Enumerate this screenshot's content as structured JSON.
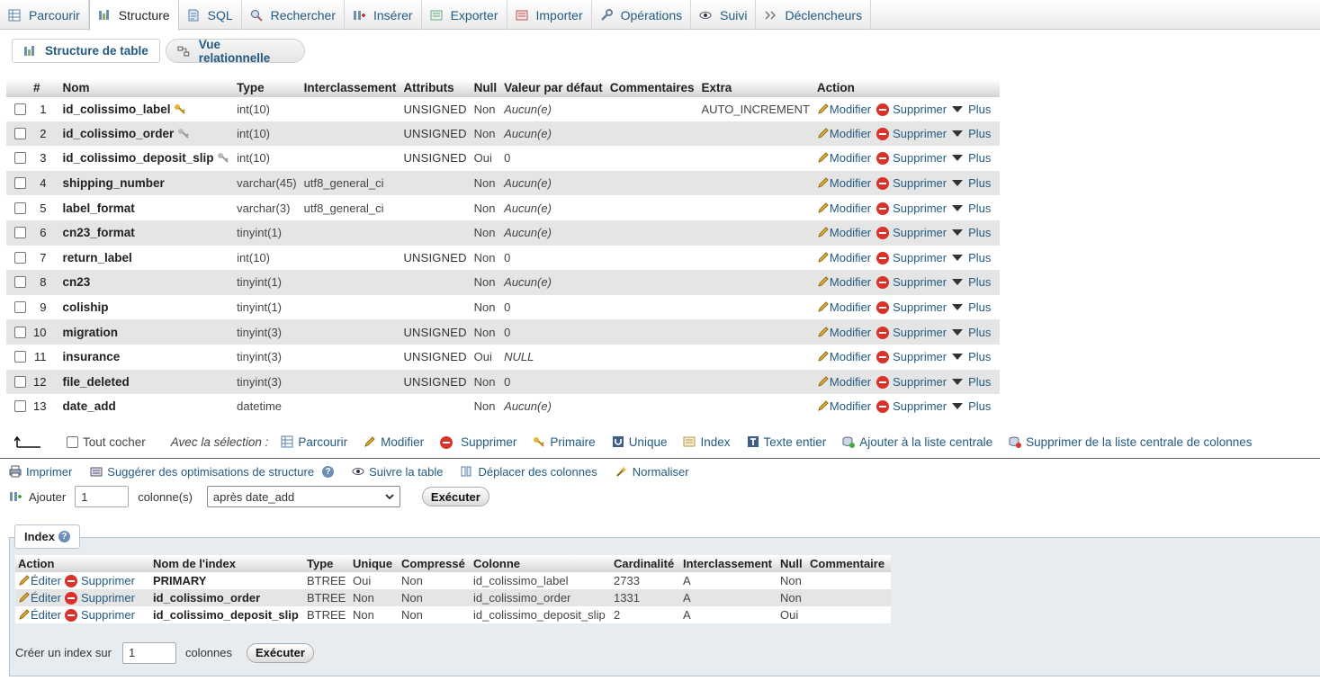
{
  "tabs": [
    {
      "label": "Parcourir",
      "icon": "browse-icon"
    },
    {
      "label": "Structure",
      "icon": "structure-icon",
      "active": true
    },
    {
      "label": "SQL",
      "icon": "sql-icon"
    },
    {
      "label": "Rechercher",
      "icon": "search-icon"
    },
    {
      "label": "Insérer",
      "icon": "insert-icon"
    },
    {
      "label": "Exporter",
      "icon": "export-icon"
    },
    {
      "label": "Importer",
      "icon": "import-icon"
    },
    {
      "label": "Opérations",
      "icon": "wrench-icon"
    },
    {
      "label": "Suivi",
      "icon": "eye-icon"
    },
    {
      "label": "Déclencheurs",
      "icon": "trigger-icon"
    }
  ],
  "subtabs": {
    "table_structure": "Structure de table",
    "relation_view": "Vue relationnelle"
  },
  "structure": {
    "headers": [
      "#",
      "Nom",
      "Type",
      "Interclassement",
      "Attributs",
      "Null",
      "Valeur par défaut",
      "Commentaires",
      "Extra",
      "Action"
    ],
    "action_labels": {
      "edit": "Modifier",
      "delete": "Supprimer",
      "more": "Plus"
    },
    "rows": [
      {
        "num": "1",
        "name": "id_colissimo_label",
        "key": "primary",
        "type": "int(10)",
        "collation": "",
        "attributes": "UNSIGNED",
        "null": "Non",
        "default": "Aucun(e)",
        "default_italic": true,
        "comments": "",
        "extra": "AUTO_INCREMENT"
      },
      {
        "num": "2",
        "name": "id_colissimo_order",
        "key": "index",
        "type": "int(10)",
        "collation": "",
        "attributes": "UNSIGNED",
        "null": "Non",
        "default": "Aucun(e)",
        "default_italic": true,
        "comments": "",
        "extra": ""
      },
      {
        "num": "3",
        "name": "id_colissimo_deposit_slip",
        "key": "index",
        "type": "int(10)",
        "collation": "",
        "attributes": "UNSIGNED",
        "null": "Oui",
        "default": "0",
        "default_italic": false,
        "comments": "",
        "extra": ""
      },
      {
        "num": "4",
        "name": "shipping_number",
        "key": "",
        "type": "varchar(45)",
        "collation": "utf8_general_ci",
        "attributes": "",
        "null": "Non",
        "default": "Aucun(e)",
        "default_italic": true,
        "comments": "",
        "extra": ""
      },
      {
        "num": "5",
        "name": "label_format",
        "key": "",
        "type": "varchar(3)",
        "collation": "utf8_general_ci",
        "attributes": "",
        "null": "Non",
        "default": "Aucun(e)",
        "default_italic": true,
        "comments": "",
        "extra": ""
      },
      {
        "num": "6",
        "name": "cn23_format",
        "key": "",
        "type": "tinyint(1)",
        "collation": "",
        "attributes": "",
        "null": "Non",
        "default": "Aucun(e)",
        "default_italic": true,
        "comments": "",
        "extra": ""
      },
      {
        "num": "7",
        "name": "return_label",
        "key": "",
        "type": "int(10)",
        "collation": "",
        "attributes": "UNSIGNED",
        "null": "Non",
        "default": "0",
        "default_italic": false,
        "comments": "",
        "extra": ""
      },
      {
        "num": "8",
        "name": "cn23",
        "key": "",
        "type": "tinyint(1)",
        "collation": "",
        "attributes": "",
        "null": "Non",
        "default": "Aucun(e)",
        "default_italic": true,
        "comments": "",
        "extra": ""
      },
      {
        "num": "9",
        "name": "coliship",
        "key": "",
        "type": "tinyint(1)",
        "collation": "",
        "attributes": "",
        "null": "Non",
        "default": "0",
        "default_italic": false,
        "comments": "",
        "extra": ""
      },
      {
        "num": "10",
        "name": "migration",
        "key": "",
        "type": "tinyint(3)",
        "collation": "",
        "attributes": "UNSIGNED",
        "null": "Non",
        "default": "0",
        "default_italic": false,
        "comments": "",
        "extra": ""
      },
      {
        "num": "11",
        "name": "insurance",
        "key": "",
        "type": "tinyint(3)",
        "collation": "",
        "attributes": "UNSIGNED",
        "null": "Oui",
        "default": "NULL",
        "default_italic": true,
        "comments": "",
        "extra": ""
      },
      {
        "num": "12",
        "name": "file_deleted",
        "key": "",
        "type": "tinyint(3)",
        "collation": "",
        "attributes": "UNSIGNED",
        "null": "Non",
        "default": "0",
        "default_italic": false,
        "comments": "",
        "extra": ""
      },
      {
        "num": "13",
        "name": "date_add",
        "key": "",
        "type": "datetime",
        "collation": "",
        "attributes": "",
        "null": "Non",
        "default": "Aucun(e)",
        "default_italic": true,
        "comments": "",
        "extra": ""
      }
    ]
  },
  "selection": {
    "check_all": "Tout cocher",
    "with_selected": "Avec la sélection :",
    "actions": [
      {
        "label": "Parcourir",
        "icon": "browse-icon"
      },
      {
        "label": "Modifier",
        "icon": "pencil-icon"
      },
      {
        "label": "Supprimer",
        "icon": "delete-icon"
      },
      {
        "label": "Primaire",
        "icon": "primary-key-icon"
      },
      {
        "label": "Unique",
        "icon": "unique-icon"
      },
      {
        "label": "Index",
        "icon": "index-icon"
      },
      {
        "label": "Texte entier",
        "icon": "fulltext-icon"
      },
      {
        "label": "Ajouter à la liste centrale",
        "icon": "add-central-icon"
      },
      {
        "label": "Supprimer de la liste centrale de colonnes",
        "icon": "remove-central-icon"
      }
    ]
  },
  "tools": [
    {
      "label": "Imprimer",
      "icon": "print-icon"
    },
    {
      "label": "Suggérer des optimisations de structure",
      "icon": "optimize-icon",
      "help": true
    },
    {
      "label": "Suivre la table",
      "icon": "eye-icon"
    },
    {
      "label": "Déplacer des colonnes",
      "icon": "move-columns-icon"
    },
    {
      "label": "Normaliser",
      "icon": "normalize-icon"
    }
  ],
  "add_columns": {
    "label": "Ajouter",
    "count": "1",
    "unit": "colonne(s)",
    "position": "après date_add",
    "submit": "Exécuter"
  },
  "index": {
    "legend": "Index",
    "headers": [
      "Action",
      "Nom de l'index",
      "Type",
      "Unique",
      "Compressé",
      "Colonne",
      "Cardinalité",
      "Interclassement",
      "Null",
      "Commentaire"
    ],
    "edit_label": "Éditer",
    "delete_label": "Supprimer",
    "rows": [
      {
        "name": "PRIMARY",
        "type": "BTREE",
        "unique": "Oui",
        "packed": "Non",
        "column": "id_colissimo_label",
        "cardinality": "2733",
        "collation": "A",
        "null": "Non",
        "comment": ""
      },
      {
        "name": "id_colissimo_order",
        "type": "BTREE",
        "unique": "Non",
        "packed": "Non",
        "column": "id_colissimo_order",
        "cardinality": "1331",
        "collation": "A",
        "null": "Non",
        "comment": ""
      },
      {
        "name": "id_colissimo_deposit_slip",
        "type": "BTREE",
        "unique": "Non",
        "packed": "Non",
        "column": "id_colissimo_deposit_slip",
        "cardinality": "2",
        "collation": "A",
        "null": "Oui",
        "comment": ""
      }
    ],
    "create_label": "Créer un index sur",
    "create_count": "1",
    "create_unit": "colonnes",
    "create_submit": "Exécuter"
  }
}
